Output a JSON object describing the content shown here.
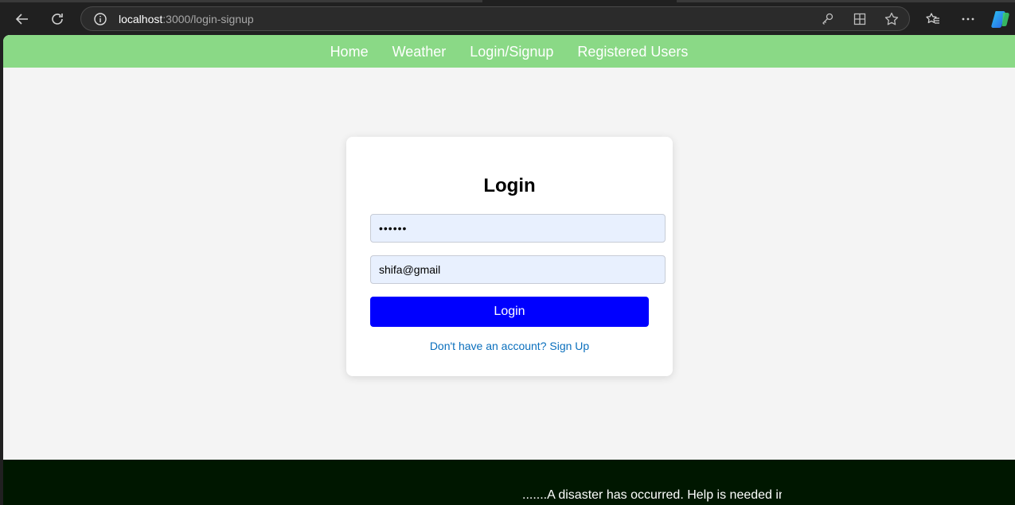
{
  "browser": {
    "address": {
      "host": "localhost",
      "path": ":3000/login-signup"
    },
    "icons": {
      "back": "back-arrow-icon",
      "refresh": "refresh-icon",
      "info": "info-icon",
      "key": "key-icon",
      "apps": "apps-icon",
      "favorite": "star-icon",
      "favorites": "favorites-icon",
      "more": "more-icon",
      "copilot": "copilot-icon"
    }
  },
  "nav": {
    "items": [
      {
        "label": "Home"
      },
      {
        "label": "Weather"
      },
      {
        "label": "Login/Signup"
      },
      {
        "label": "Registered Users"
      }
    ],
    "background": "#8ad986"
  },
  "login": {
    "title": "Login",
    "password_value": "••••••",
    "email_value": "shifa@gmail",
    "button_label": "Login",
    "switch_text": "Don't have an account? Sign Up",
    "button_color": "#0000ff",
    "link_color": "#0a6fbd"
  },
  "banner": {
    "text": ".......A disaster has occurred. Help is needed in",
    "background": "#001700"
  }
}
